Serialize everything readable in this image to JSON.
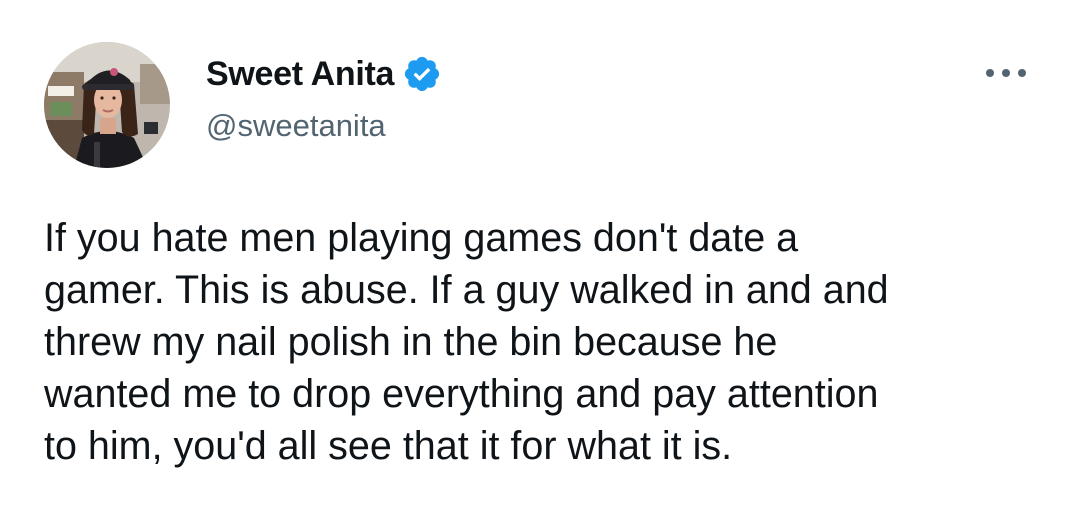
{
  "tweet": {
    "author": {
      "display_name": "Sweet Anita",
      "handle": "@sweetanita",
      "verified": true,
      "avatar_icon": "avatar-photo"
    },
    "more_icon": "more-options-icon",
    "text": "If you hate men playing games don't date a\ngamer. This is abuse. If a guy walked in and and\nthrew my nail polish in the bin because he\nwanted me to drop everything and pay attention\nto him, you'd all see that it for what it is."
  },
  "colors": {
    "verified_badge": "#1d9bf0",
    "handle_text": "#536471",
    "body_text": "#0f1419"
  }
}
